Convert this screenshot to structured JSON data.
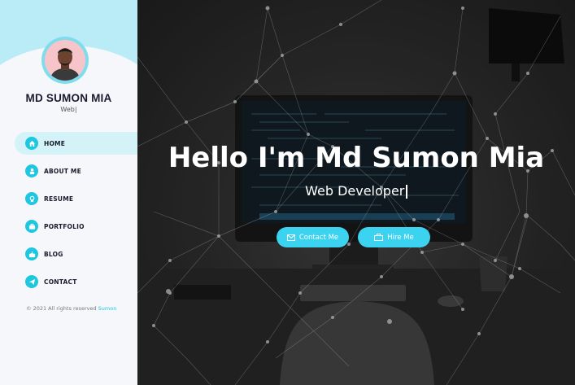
{
  "profile": {
    "name": "MD SUMON MIA",
    "subtitle": "Web|"
  },
  "nav": {
    "items": [
      {
        "label": "HOME",
        "icon": "home-icon",
        "active": true
      },
      {
        "label": "ABOUT ME",
        "icon": "user-icon",
        "active": false
      },
      {
        "label": "RESUME",
        "icon": "award-icon",
        "active": false
      },
      {
        "label": "PORTFOLIO",
        "icon": "briefcase-icon",
        "active": false
      },
      {
        "label": "BLOG",
        "icon": "inbox-icon",
        "active": false
      },
      {
        "label": "CONTACT",
        "icon": "send-icon",
        "active": false
      }
    ]
  },
  "footer": {
    "copyright_prefix": "© 2021 All rights reserved",
    "brand": "Sumon"
  },
  "hero": {
    "greeting": "Hello I'm",
    "name": "Md Sumon Mia",
    "role": "Web Developer",
    "contact_label": "Contact Me",
    "hire_label": "Hire Me"
  },
  "colors": {
    "accent": "#1ec6e0",
    "button": "#3bd3ef",
    "sidebar_top": "#b9ecf7",
    "sidebar_bg": "#f6f7fb",
    "active_nav": "#d3f3f8"
  }
}
